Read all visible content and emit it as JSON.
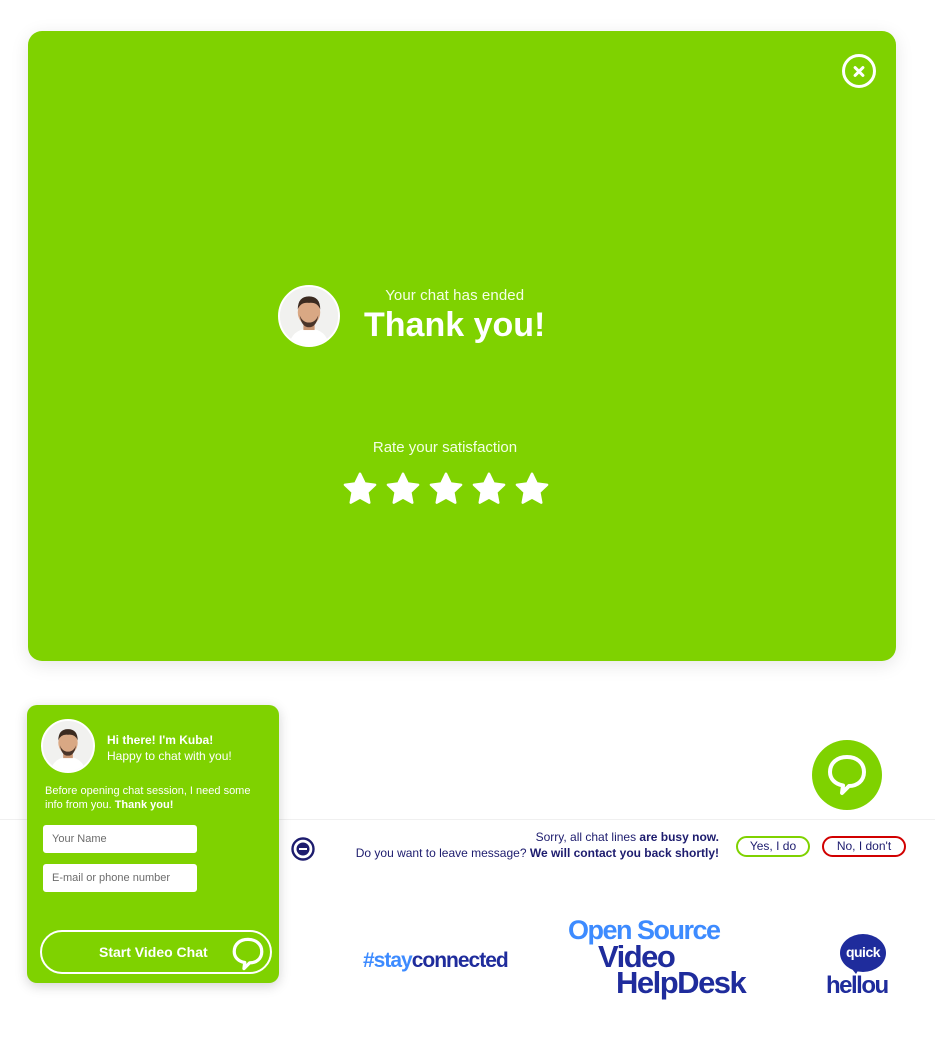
{
  "panel": {
    "subtitle": "Your chat has ended",
    "title": "Thank you!",
    "rate_label": "Rate your satisfaction",
    "stars_total": 5
  },
  "notice": {
    "line1_a": "Sorry, all chat lines ",
    "line1_b": "are busy now.",
    "line2_a": "Do you want to leave message? ",
    "line2_b": "We will contact you back shortly!",
    "yes_label": "Yes, I do",
    "no_label": "No, I don't"
  },
  "widget": {
    "greeting": "Hi there! I'm Kuba!",
    "greeting_sub": "Happy to chat with you!",
    "info_a": "Before opening chat session, I need some info from you. ",
    "info_b": "Thank you!",
    "name_placeholder": "Your Name",
    "contact_placeholder": "E-mail or phone number",
    "start_label": "Start Video Chat"
  },
  "branding": {
    "hashtag_a": "#stay",
    "hashtag_b": "connected",
    "os_line1": "Open Source",
    "os_line2": "Video",
    "os_line3": "HelpDesk",
    "qh_top": "quick",
    "qh_bottom": "hellou"
  },
  "colors": {
    "accent": "#7fd200",
    "navy": "#1d1c6e",
    "blue": "#3d8bff",
    "danger": "#d10000"
  },
  "icons": {
    "close": "close-circle-icon",
    "star": "star-icon",
    "chat": "chat-bubble-icon",
    "busy": "minus-circle-icon"
  }
}
